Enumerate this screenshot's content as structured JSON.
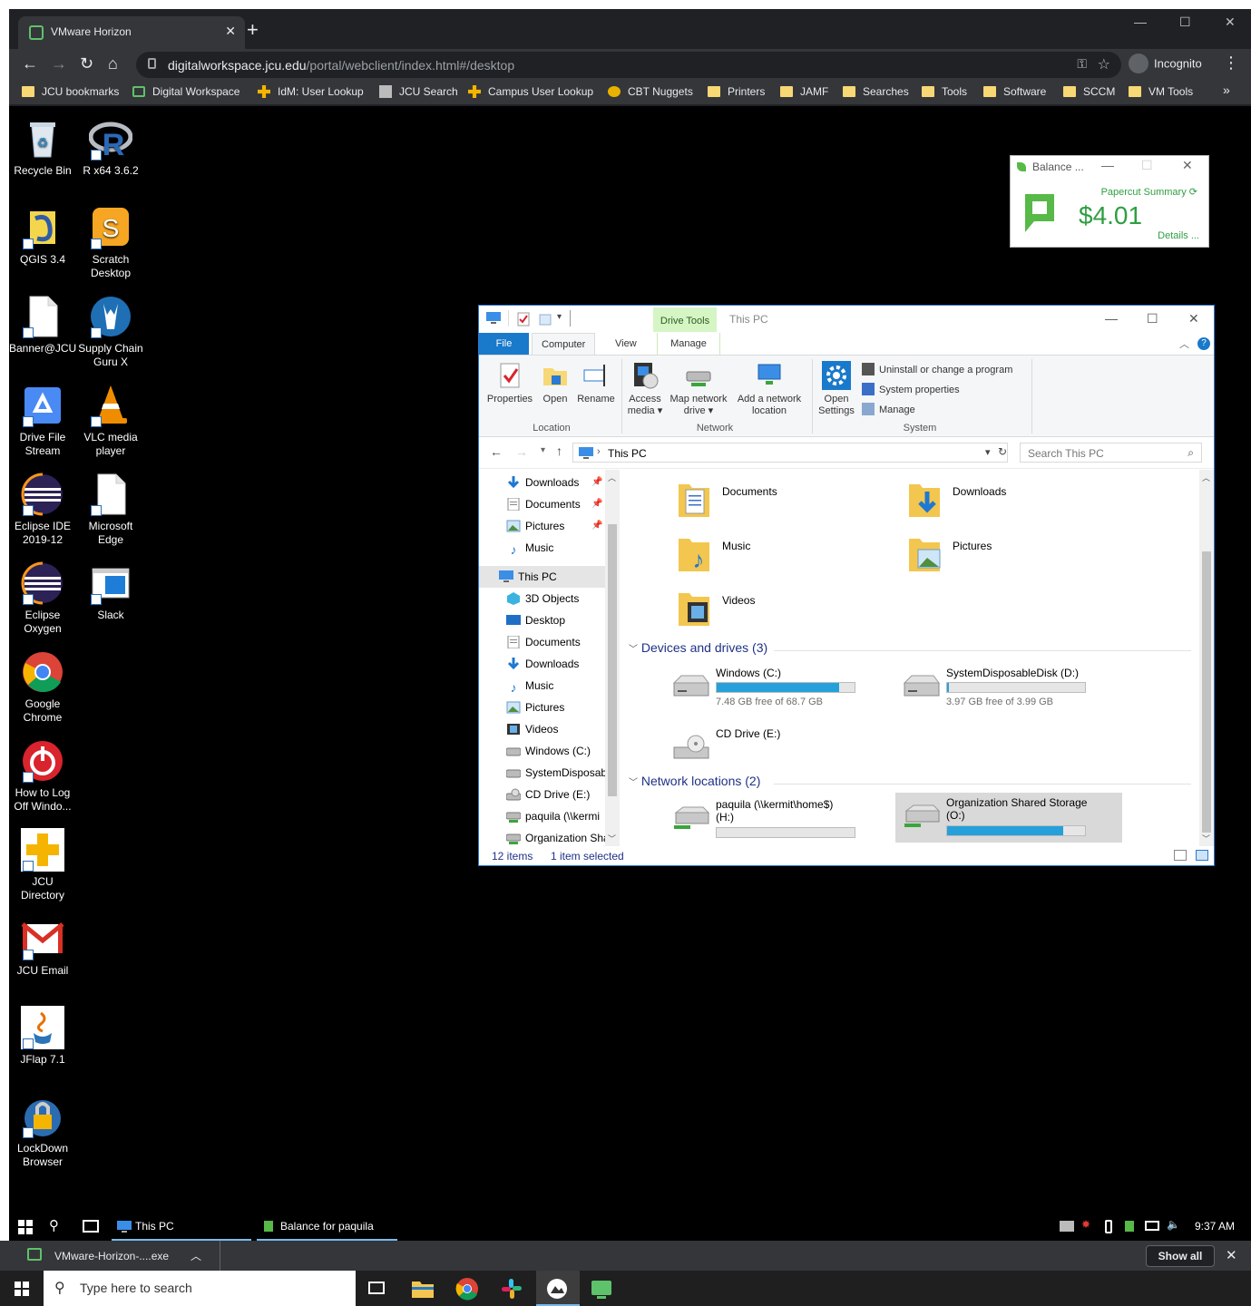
{
  "browser": {
    "tab_title": "VMware Horizon",
    "new_tab": "+",
    "url_host": "digitalworkspace.jcu.edu",
    "url_path": "/portal/webclient/index.html#/desktop",
    "profile": "Incognito",
    "bookmarks": [
      {
        "label": "JCU bookmarks",
        "icon": "folder-icon"
      },
      {
        "label": "Digital Workspace",
        "icon": "horizon-icon"
      },
      {
        "label": "IdM: User Lookup",
        "icon": "plus-icon"
      },
      {
        "label": "JCU Search",
        "icon": "jcu-icon"
      },
      {
        "label": "Campus User Lookup",
        "icon": "plus-icon"
      },
      {
        "label": "CBT Nuggets",
        "icon": "cbt-icon"
      },
      {
        "label": "Printers",
        "icon": "folder-icon"
      },
      {
        "label": "JAMF",
        "icon": "folder-icon"
      },
      {
        "label": "Searches",
        "icon": "folder-icon"
      },
      {
        "label": "Tools",
        "icon": "folder-icon"
      },
      {
        "label": "Software",
        "icon": "folder-icon"
      },
      {
        "label": "SCCM",
        "icon": "folder-icon"
      },
      {
        "label": "VM Tools",
        "icon": "folder-icon"
      }
    ],
    "more": "»"
  },
  "desktop_icons": [
    {
      "label": "Recycle Bin",
      "icon": "recycle-bin-icon"
    },
    {
      "label": "R x64 3.6.2",
      "icon": "r-icon"
    },
    {
      "label": "QGIS 3.4",
      "icon": "qgis-icon"
    },
    {
      "label": "Scratch Desktop",
      "icon": "scratch-icon"
    },
    {
      "label": "Banner@JCU",
      "icon": "document-icon"
    },
    {
      "label": "Supply Chain Guru X",
      "icon": "supply-chain-icon"
    },
    {
      "label": "Drive File Stream",
      "icon": "drive-icon"
    },
    {
      "label": "VLC media player",
      "icon": "vlc-icon"
    },
    {
      "label": "Eclipse IDE 2019-12",
      "icon": "eclipse-icon"
    },
    {
      "label": "Microsoft Edge",
      "icon": "document-icon"
    },
    {
      "label": "Eclipse Oxygen",
      "icon": "eclipse-icon"
    },
    {
      "label": "Slack",
      "icon": "slack-window-icon"
    },
    {
      "label": "Google Chrome",
      "icon": "chrome-icon"
    },
    {
      "label": "How to Log Off Windo...",
      "icon": "power-icon"
    },
    {
      "label": "JCU Directory",
      "icon": "directory-icon"
    },
    {
      "label": "JCU Email",
      "icon": "gmail-icon"
    },
    {
      "label": "JFlap 7.1",
      "icon": "java-icon"
    },
    {
      "label": "LockDown Browser",
      "icon": "lockdown-icon"
    }
  ],
  "papercut": {
    "title": "Balance ...",
    "summary": "Papercut Summary",
    "amount": "$4.01",
    "details": "Details ..."
  },
  "explorer": {
    "context_tab": "Drive Tools",
    "title": "This PC",
    "tabs": [
      "File",
      "Computer",
      "View",
      "Manage"
    ],
    "ribbon": {
      "location": {
        "group": "Location",
        "properties": "Properties",
        "open": "Open",
        "rename": "Rename"
      },
      "network": {
        "group": "Network",
        "access_media_1": "Access",
        "access_media_2": "media",
        "map_drive_1": "Map network",
        "map_drive_2": "drive",
        "add_location_1": "Add a network",
        "add_location_2": "location"
      },
      "system": {
        "group": "System",
        "open_settings_1": "Open",
        "open_settings_2": "Settings",
        "uninstall": "Uninstall or change a program",
        "sys_props": "System properties",
        "manage": "Manage"
      }
    },
    "address": "This PC",
    "search_placeholder": "Search This PC",
    "nav_quick": [
      "Downloads",
      "Documents",
      "Pictures",
      "Music"
    ],
    "nav_thispc": "This PC",
    "nav_items": [
      "3D Objects",
      "Desktop",
      "Documents",
      "Downloads",
      "Music",
      "Pictures",
      "Videos",
      "Windows (C:)",
      "SystemDisposab",
      "CD Drive (E:)",
      "paquila (\\\\kermi",
      "Organization Sha"
    ],
    "folders": [
      "Documents",
      "Downloads",
      "Music",
      "Pictures",
      "Videos"
    ],
    "devices_header": "Devices and drives (3)",
    "drives": [
      {
        "name": "Windows (C:)",
        "free": "7.48 GB free of 68.7 GB",
        "used_fraction": 0.89
      },
      {
        "name": "SystemDisposableDisk (D:)",
        "free": "3.97 GB free of 3.99 GB",
        "used_fraction": 0.01
      },
      {
        "name": "CD Drive (E:)",
        "free": "",
        "used_fraction": null
      }
    ],
    "network_header": "Network locations (2)",
    "network": [
      {
        "name": "paquila (\\\\kermit\\home$)",
        "name2": "(H:)",
        "used_fraction": 0.0
      },
      {
        "name": "Organization Shared Storage",
        "name2": "(O:)",
        "used_fraction": 0.84
      }
    ],
    "status_items": "12 items",
    "status_selected": "1 item selected"
  },
  "remote_taskbar": {
    "app1": "This PC",
    "app2": "Balance for paquila",
    "time": "9:37 AM"
  },
  "download_bar": {
    "file": "VMware-Horizon-....exe",
    "show_all": "Show all"
  },
  "local_taskbar": {
    "search_placeholder": "Type here to search"
  }
}
